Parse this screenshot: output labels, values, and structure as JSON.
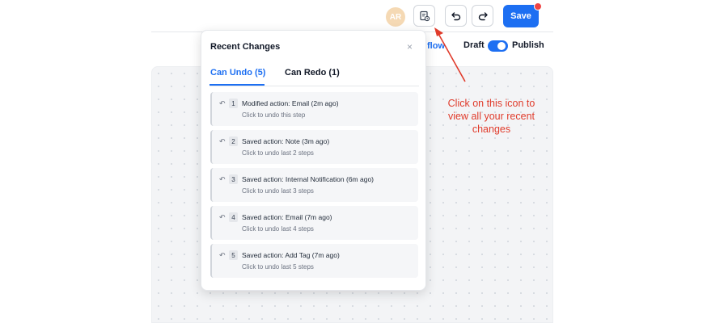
{
  "toolbar": {
    "avatar_initials": "AR",
    "save_label": "Save",
    "changes_icon": "history-doc-icon",
    "undo_icon": "undo-icon",
    "redo_icon": "redo-icon",
    "save_color": "#1d6ff2",
    "notification_color": "#ef4444"
  },
  "subbar": {
    "link_text": "flow",
    "draft_label": "Draft",
    "publish_label": "Publish",
    "publish_toggle_on": true
  },
  "popup": {
    "title": "Recent Changes",
    "close_symbol": "×",
    "tabs": [
      {
        "label": "Can Undo (5)",
        "active": true
      },
      {
        "label": "Can Redo (1)",
        "active": false
      }
    ],
    "items": [
      {
        "num": "1",
        "title": "Modified action: Email (2m ago)",
        "sub": "Click to undo this step"
      },
      {
        "num": "2",
        "title": "Saved action: Note (3m ago)",
        "sub": "Click to undo last 2 steps"
      },
      {
        "num": "3",
        "title": "Saved action: Internal Notification (6m ago)",
        "sub": "Click to undo last 3 steps"
      },
      {
        "num": "4",
        "title": "Saved action: Email (7m ago)",
        "sub": "Click to undo last 4 steps"
      },
      {
        "num": "5",
        "title": "Saved action: Add Tag (7m ago)",
        "sub": "Click to undo last 5 steps"
      }
    ]
  },
  "annotation": {
    "text": "Click on this icon to view all your recent changes",
    "color": "#e03b2b"
  }
}
